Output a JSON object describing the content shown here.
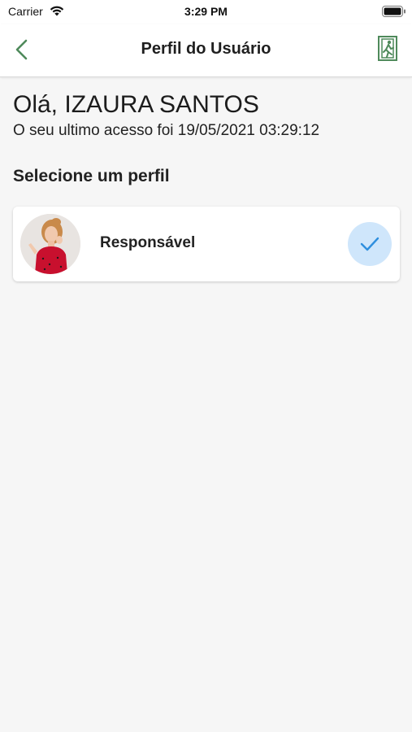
{
  "status_bar": {
    "carrier": "Carrier",
    "time": "3:29 PM"
  },
  "nav": {
    "title": "Perfil do Usuário",
    "back_icon": "chevron-left-icon",
    "exit_icon": "emergency-exit-icon",
    "accent_color": "#4f8a5b"
  },
  "greeting": {
    "hello": "Olá, IZAURA SANTOS",
    "last_access": "O seu ultimo acesso foi 19/05/2021 03:29:12"
  },
  "profiles": {
    "section_title": "Selecione um perfil",
    "items": [
      {
        "label": "Responsável",
        "selected": true,
        "check_color": "#2f8fde",
        "badge_color": "#cfe6fb"
      }
    ]
  }
}
